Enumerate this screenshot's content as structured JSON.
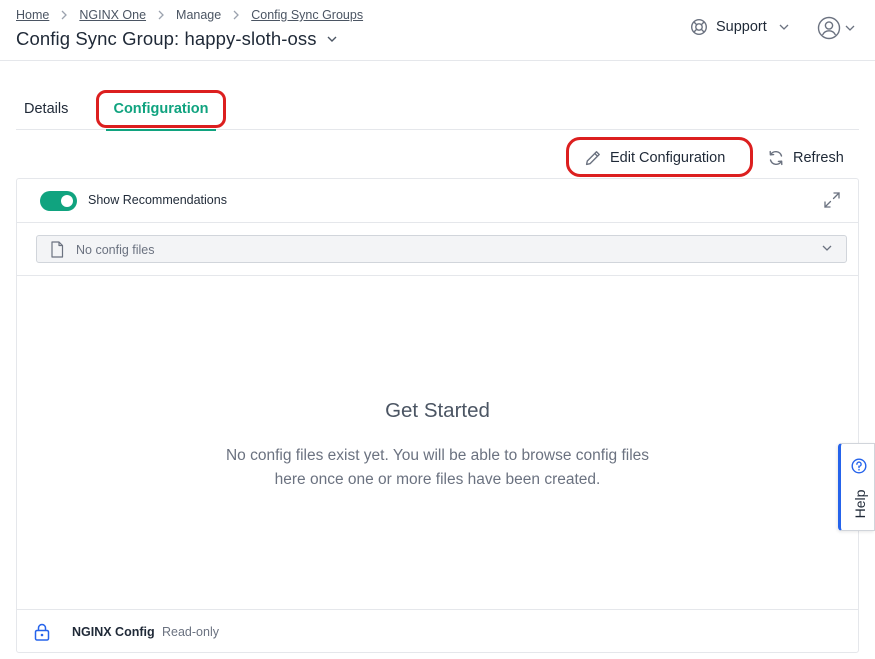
{
  "breadcrumb": {
    "items": [
      "Home",
      "NGINX One",
      "Manage",
      "Config Sync Groups"
    ]
  },
  "page": {
    "title": "Config Sync Group: happy-sloth-oss"
  },
  "header": {
    "support_label": "Support"
  },
  "tabs": [
    {
      "label": "Details",
      "active": false
    },
    {
      "label": "Configuration",
      "active": true
    }
  ],
  "actions": {
    "edit_label": "Edit Configuration",
    "refresh_label": "Refresh"
  },
  "panel": {
    "show_recommendations_label": "Show Recommendations",
    "show_recommendations_on": true,
    "file_select_value": "No config files",
    "empty_title": "Get Started",
    "empty_description_line1": "No config files exist yet. You will be able to browse config files",
    "empty_description_line2": "here once one or more files have been created.",
    "footer_name": "NGINX Config",
    "footer_status": "Read-only"
  },
  "help": {
    "label": "Help"
  },
  "colors": {
    "accent": "#10a37f",
    "highlight": "#dc1f1f",
    "help_border": "#2563eb"
  },
  "icons": [
    "chevron-right-icon",
    "chevron-down-icon",
    "lifebuoy-icon",
    "user-circle-icon",
    "pencil-icon",
    "refresh-icon",
    "expand-icon",
    "file-icon",
    "lock-icon",
    "help-circle-icon"
  ]
}
